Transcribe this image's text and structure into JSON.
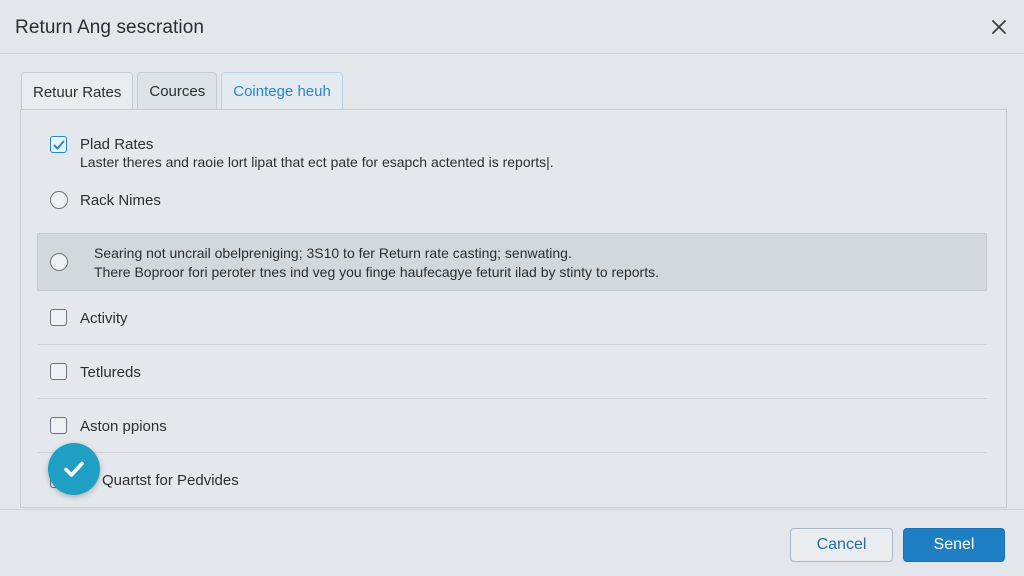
{
  "window": {
    "title": "Return Ang sescration"
  },
  "tabs": [
    {
      "label": "Retuur Rates"
    },
    {
      "label": "Cources"
    },
    {
      "label": "Cointege heuh"
    }
  ],
  "options": {
    "plaid_rates": {
      "label": "Plad Rates",
      "description": "Laster theres and raoie lort lipat that ect pate for esapch actented is reports|.",
      "checked": true
    },
    "rack_names": {
      "label": "Rack Nimes"
    },
    "note": {
      "line1": "Searing not uncrail obelpreniging; 3S10 to fer Return rate casting; senwating.",
      "line2": "There Boproor fori peroter tnes ind veg you finge haufecagye feturit ilad by stinty to reports."
    },
    "activity": {
      "label": "Activity"
    },
    "tetlureds": {
      "label": "Tetlureds"
    },
    "aston_ppions": {
      "label": "Aston ppions"
    },
    "quartst": {
      "label": "Quartst for Pedvides"
    }
  },
  "footer": {
    "cancel_label": "Cancel",
    "primary_label": "Senel"
  },
  "colors": {
    "accent": "#1f7fc4",
    "fab": "#1f9fc4",
    "tab_highlight": "#2a86c6"
  },
  "icons": {
    "close": "close-icon",
    "check": "check-icon",
    "fab": "checkmark-icon"
  }
}
